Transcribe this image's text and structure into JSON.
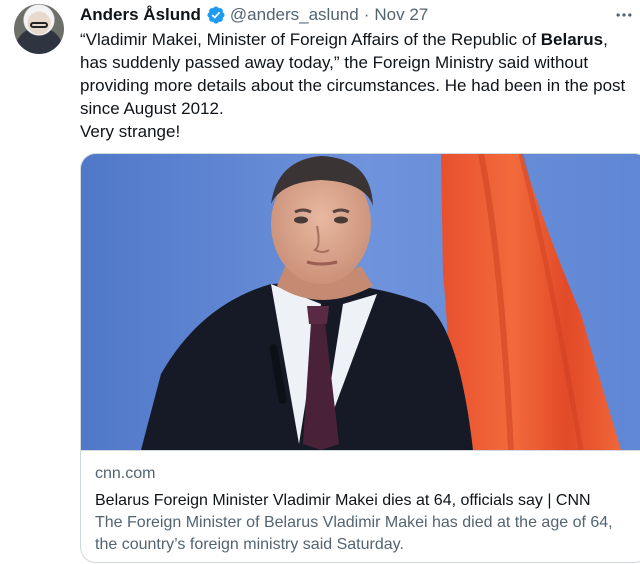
{
  "tweet": {
    "author_name": "Anders Åslund",
    "handle": "@anders_aslund",
    "separator": "·",
    "timestamp": "Nov 27",
    "text_quote_before_bold": "“Vladimir Makei, Minister of Foreign Affairs of the Republic of ",
    "text_bold": "Belarus",
    "text_quote_after_bold": ", has suddenly passed away today,” the Foreign Ministry said without providing more details about the circumstances. He had been in the post since August 2012.",
    "text_comment": "Very strange!"
  },
  "card": {
    "domain": "cnn.com",
    "title": "Belarus Foreign Minister Vladimir Makei dies at 64, officials say | CNN",
    "description": "The Foreign Minister of Belarus Vladimir Makei has died at the age of 64, the country’s foreign ministry said Saturday."
  },
  "colors": {
    "verified_badge": "#1d9bf0",
    "secondary_text": "#536471",
    "border": "#cfd9de"
  },
  "icons": {
    "verified": "verified-badge-icon",
    "more": "more-options-icon"
  }
}
